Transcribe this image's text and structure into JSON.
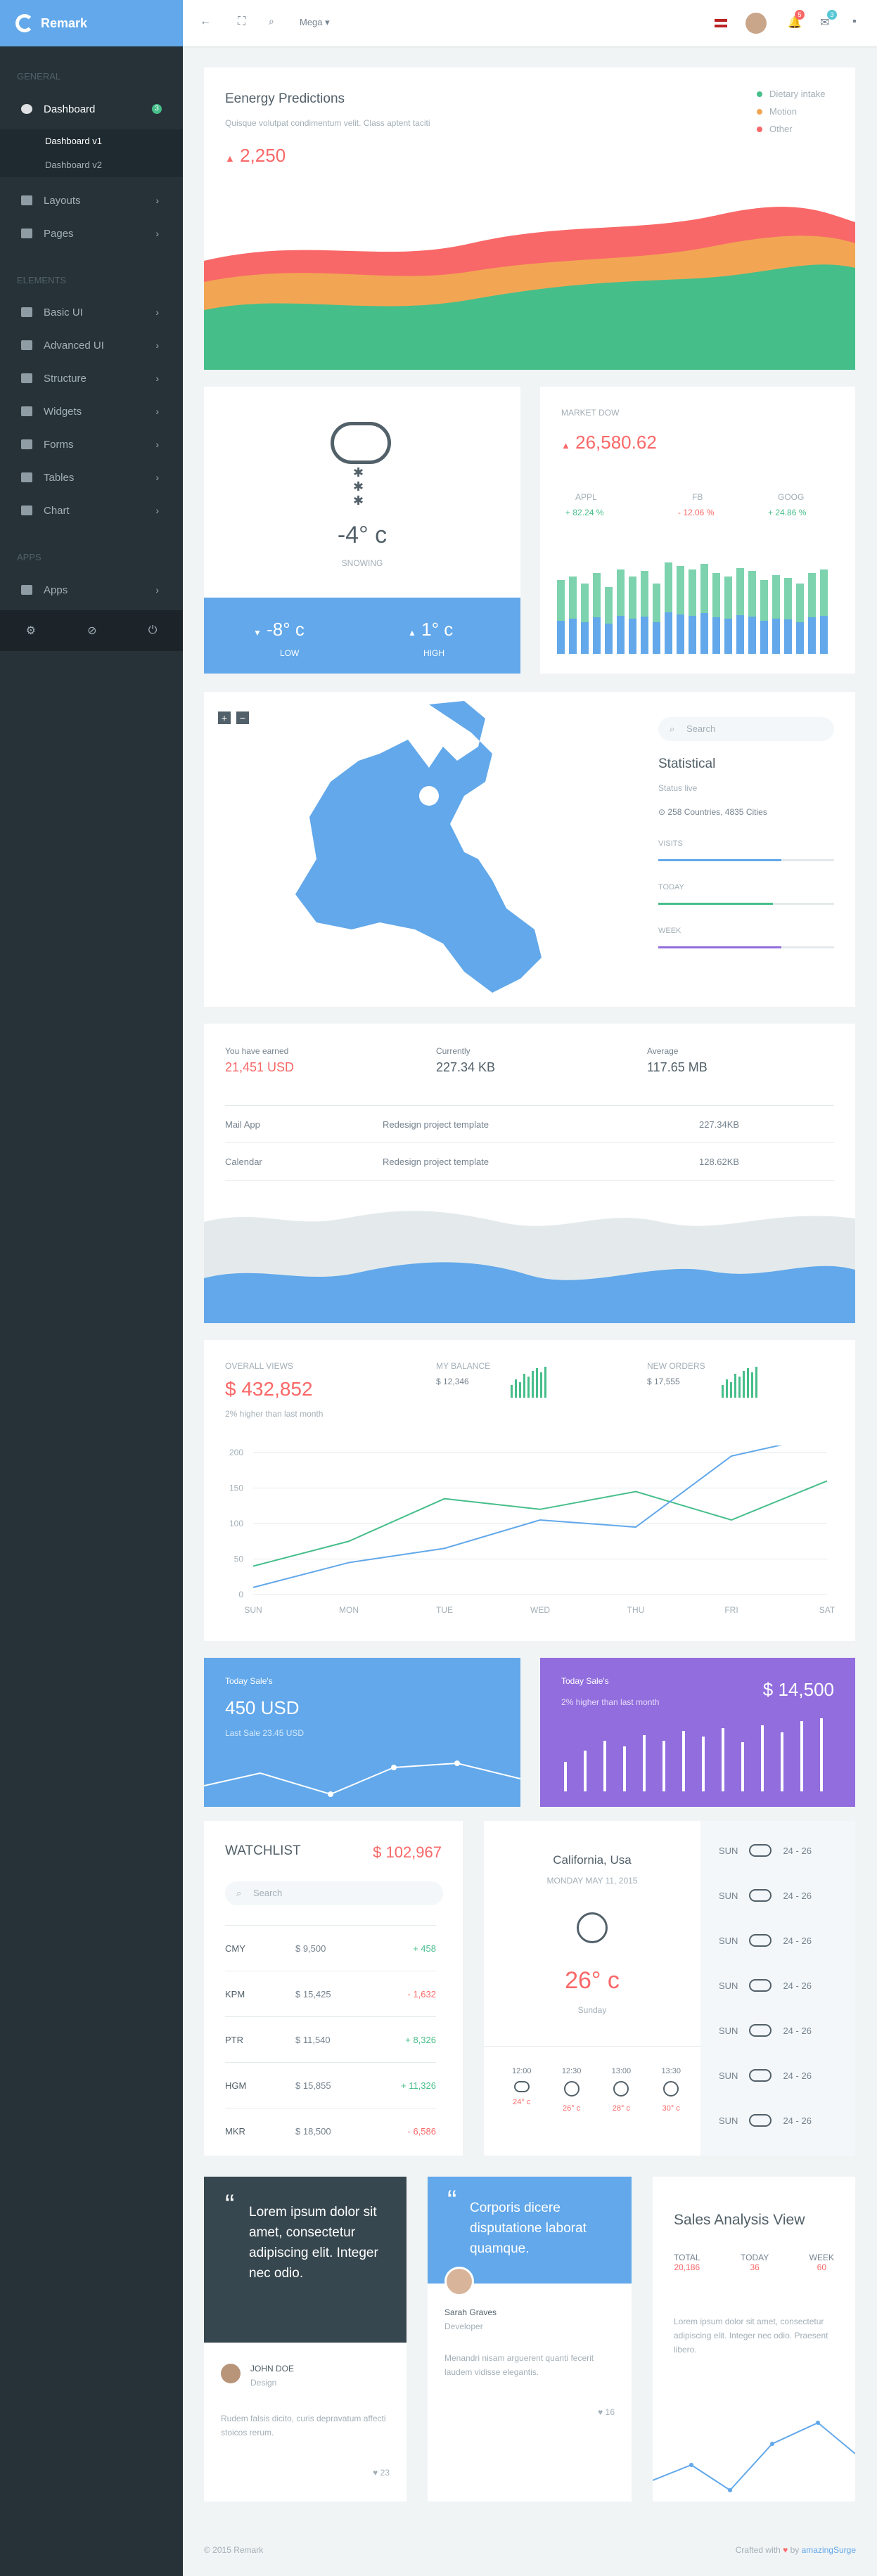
{
  "brand": "Remark",
  "sidebar": {
    "categories": [
      "General",
      "Elements",
      "Apps"
    ],
    "items": [
      {
        "label": "Dashboard",
        "badge": "3"
      },
      {
        "label": "Layouts"
      },
      {
        "label": "Pages"
      },
      {
        "label": "Basic UI"
      },
      {
        "label": "Advanced UI"
      },
      {
        "label": "Structure"
      },
      {
        "label": "Widgets"
      },
      {
        "label": "Forms"
      },
      {
        "label": "Tables"
      },
      {
        "label": "Chart"
      },
      {
        "label": "Apps"
      }
    ],
    "subitems": [
      "Dashboard v1",
      "Dashboard v2"
    ]
  },
  "topbar": {
    "mega": "Mega",
    "notif_count": "5",
    "msg_count": "3"
  },
  "energy": {
    "title": "Eenergy Predictions",
    "subtitle": "Quisque volutpat condimentum velit. Class aptent taciti",
    "value": "2,250",
    "legend": [
      "Dietary intake",
      "Motion",
      "Other"
    ],
    "colors": [
      "#46be8a",
      "#f2a654",
      "#f96868"
    ]
  },
  "weather": {
    "temp": "-4° c",
    "cond": "SNOWING",
    "low": "-8° c",
    "low_label": "LOW",
    "high": "1° c",
    "high_label": "HIGH"
  },
  "market": {
    "label": "MARKET DOW",
    "value": "26,580.62",
    "stocks": [
      {
        "name": "APPL",
        "change": "+ 82.24 %"
      },
      {
        "name": "FB",
        "change": "- 12.06 %"
      },
      {
        "name": "GOOG",
        "change": "+ 24.86 %"
      }
    ]
  },
  "map": {
    "search_placeholder": "Search",
    "title": "Statistical",
    "status": "Status live",
    "countries": "258 Countries, 4835 Cities",
    "bars": [
      {
        "label": "VISITS",
        "pct": 70,
        "color": "#62a8ea"
      },
      {
        "label": "TODAY",
        "pct": 65,
        "color": "#46be8a"
      },
      {
        "label": "WEEK",
        "pct": 70,
        "color": "#926dde"
      }
    ]
  },
  "earn": {
    "cols": [
      {
        "label": "You have earned",
        "value": "21,451 USD"
      },
      {
        "label": "Currently",
        "value": "227.34 KB"
      },
      {
        "label": "Average",
        "value": "117.65 MB"
      }
    ],
    "rows": [
      [
        "Mail App",
        "Redesign project template",
        "227.34KB"
      ],
      [
        "Calendar",
        "Redesign project template",
        "128.62KB"
      ]
    ]
  },
  "views": {
    "overall_label": "OVERALL VIEWS",
    "overall": "$ 432,852",
    "note": "2% higher than last month",
    "balance_label": "MY BALANCE",
    "balance": "$ 12,346",
    "orders_label": "NEW ORDERS",
    "orders": "$ 17,555"
  },
  "chart_data": {
    "type": "line",
    "categories": [
      "SUN",
      "MON",
      "TUE",
      "WED",
      "THU",
      "FRI",
      "SAT"
    ],
    "ylim": [
      0,
      200
    ],
    "yticks": [
      0,
      50,
      100,
      150,
      200
    ],
    "series": [
      {
        "color": "#46be8a",
        "values": [
          40,
          75,
          135,
          120,
          145,
          105,
          160
        ]
      },
      {
        "color": "#62a8ea",
        "values": [
          10,
          45,
          65,
          105,
          95,
          195,
          225
        ]
      }
    ]
  },
  "sale1": {
    "label": "Today Sale's",
    "value": "450 USD",
    "note": "Last Sale 23.45 USD"
  },
  "sale2": {
    "label": "Today Sale's",
    "value": "$ 14,500",
    "note": "2% higher than last month"
  },
  "watch": {
    "title": "WATCHLIST",
    "total": "$ 102,967",
    "search": "Search",
    "rows": [
      [
        "CMY",
        "$ 9,500",
        "+ 458"
      ],
      [
        "KPM",
        "$ 15,425",
        "- 1,632"
      ],
      [
        "PTR",
        "$ 11,540",
        "+ 8,326"
      ],
      [
        "HGM",
        "$ 15,855",
        "+ 11,326"
      ],
      [
        "MKR",
        "$ 18,500",
        "- 6,586"
      ]
    ]
  },
  "city": {
    "name": "California, Usa",
    "date": "MONDAY MAY 11, 2015",
    "temp": "26° c",
    "day": "Sunday",
    "hours": [
      {
        "t": "12:00",
        "v": "24° c"
      },
      {
        "t": "12:30",
        "v": "26° c"
      },
      {
        "t": "13:00",
        "v": "28° c"
      },
      {
        "t": "13:30",
        "v": "30° c"
      }
    ]
  },
  "forecast": {
    "day": "SUN",
    "range": "24 - 26"
  },
  "card1": {
    "quote": "Lorem ipsum dolor sit amet, consectetur adipiscing elit. Integer nec odio.",
    "name": "JOHN DOE",
    "role": "Design",
    "text": "Rudem falsis dicito, curis depravatum affecti stoicos rerum.",
    "likes": "23"
  },
  "card2": {
    "quote": "Corporis dicere disputatione laborat quamque.",
    "name": "Sarah Graves",
    "role": "Developer",
    "text": "Menandri nisam arguerent quanti fecerit laudem vidisse elegantis.",
    "likes": "16"
  },
  "sales": {
    "title": "Sales Analysis View",
    "stats": [
      {
        "label": "TOTAL",
        "value": "20,186"
      },
      {
        "label": "TODAY",
        "value": "36"
      },
      {
        "label": "WEEK",
        "value": "60"
      }
    ],
    "text": "Lorem ipsum dolor sit amet, consectetur adipiscing elit. Integer nec odio. Praesent libero."
  },
  "footer": {
    "copy": "© 2015 Remark",
    "crafted": "Crafted with",
    "by": "by",
    "author": "amazingSurge"
  }
}
